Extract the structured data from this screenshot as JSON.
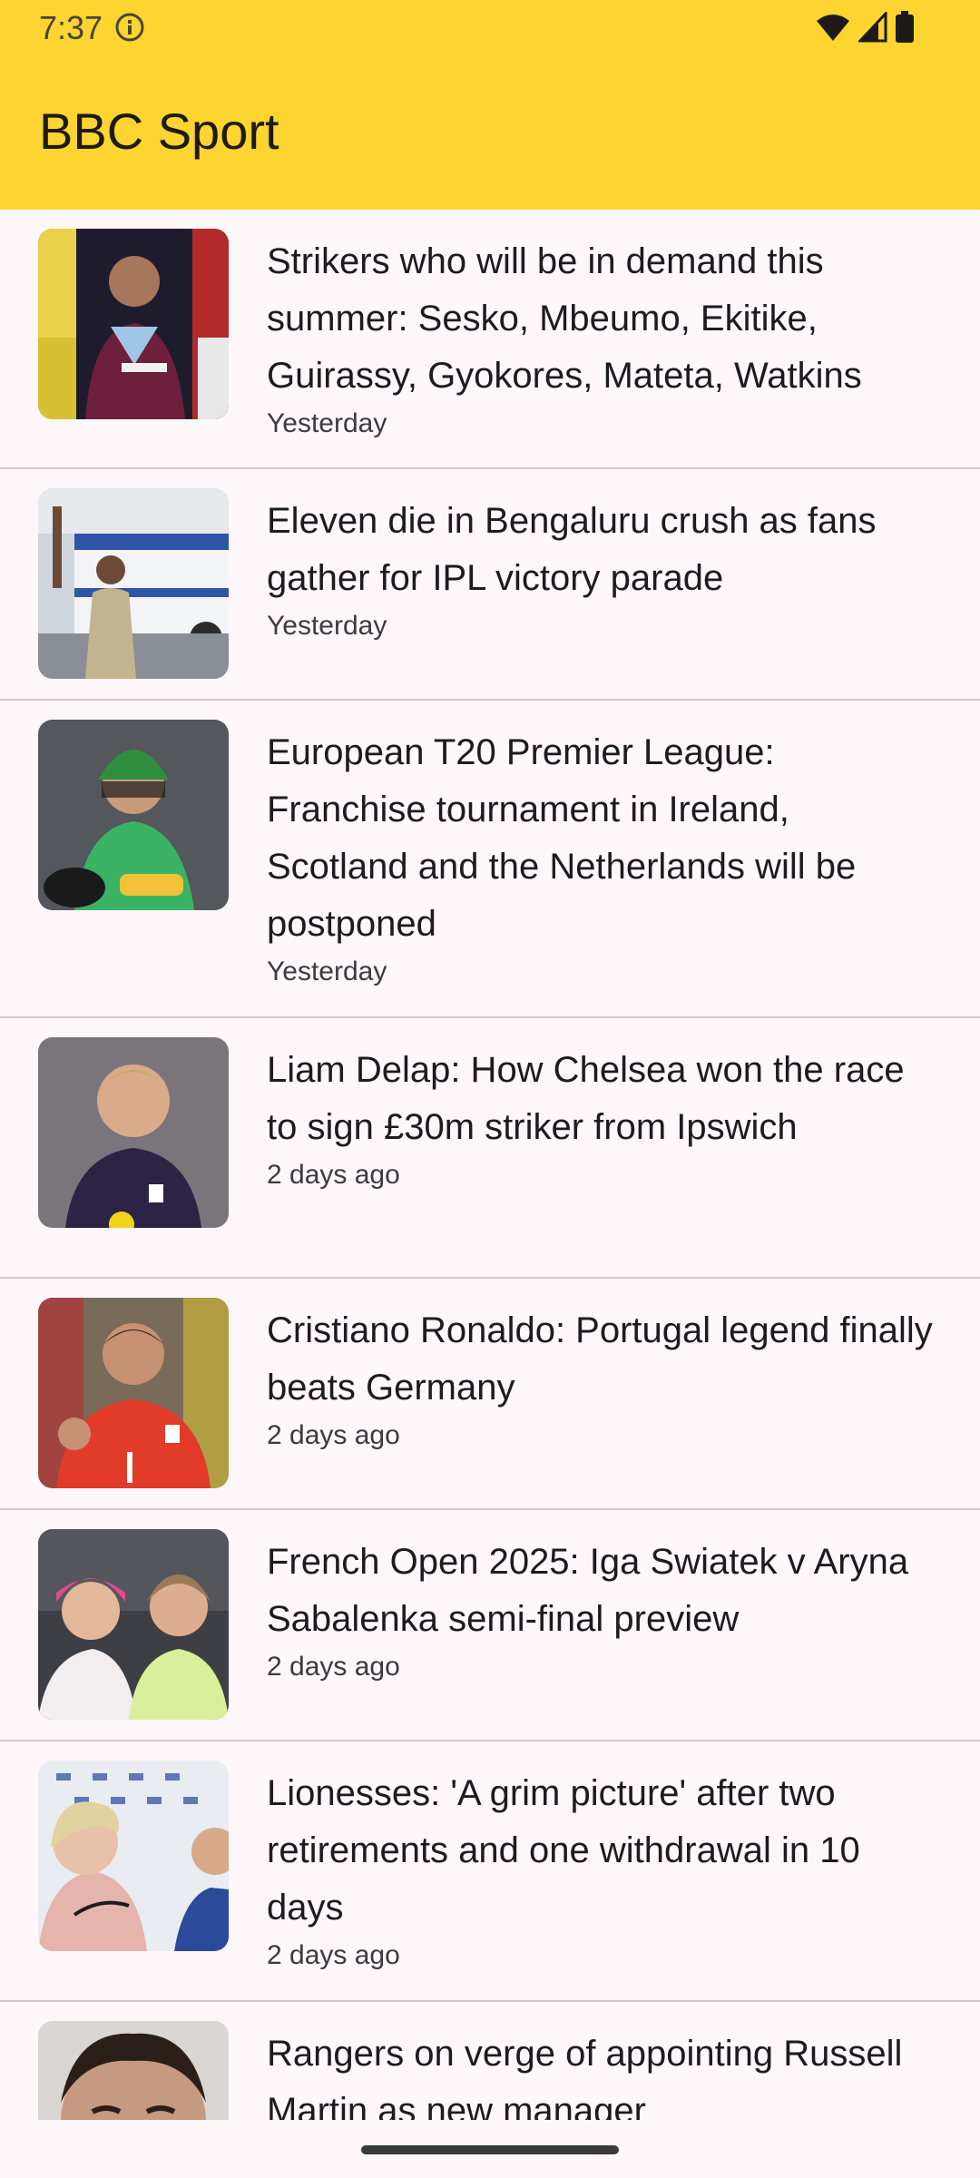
{
  "status_bar": {
    "time": "7:37",
    "info_icon": "info-circle-icon",
    "wifi_icon": "wifi-icon",
    "signal_icon": "cell-signal-icon",
    "battery_icon": "battery-icon"
  },
  "app_bar": {
    "title": "BBC Sport",
    "background_color": "#fed430"
  },
  "articles": [
    {
      "headline": "Strikers who will be in demand this summer: Sesko, Mbeumo, Ekitike, Guirassy, Gyokores, Mateta, Watkins",
      "time": "Yesterday"
    },
    {
      "headline": "Eleven die in Bengaluru crush as fans gather for IPL victory parade",
      "time": "Yesterday"
    },
    {
      "headline": "European T20 Premier League: Franchise tournament in Ireland, Scotland and the Netherlands will be postponed",
      "time": "Yesterday"
    },
    {
      "headline": "Liam Delap: How Chelsea won the race to sign £30m striker from Ipswich",
      "time": "2 days ago"
    },
    {
      "headline": "Cristiano Ronaldo: Portugal legend finally beats Germany",
      "time": "2 days ago"
    },
    {
      "headline": "French Open 2025: Iga Swiatek v Aryna Sabalenka semi-final preview",
      "time": "2 days ago"
    },
    {
      "headline": "Lionesses: 'A grim picture' after two retirements and one withdrawal in 10 days",
      "time": "2 days ago"
    },
    {
      "headline": "Rangers on verge of appointing Russell Martin as new manager",
      "time": ""
    }
  ]
}
